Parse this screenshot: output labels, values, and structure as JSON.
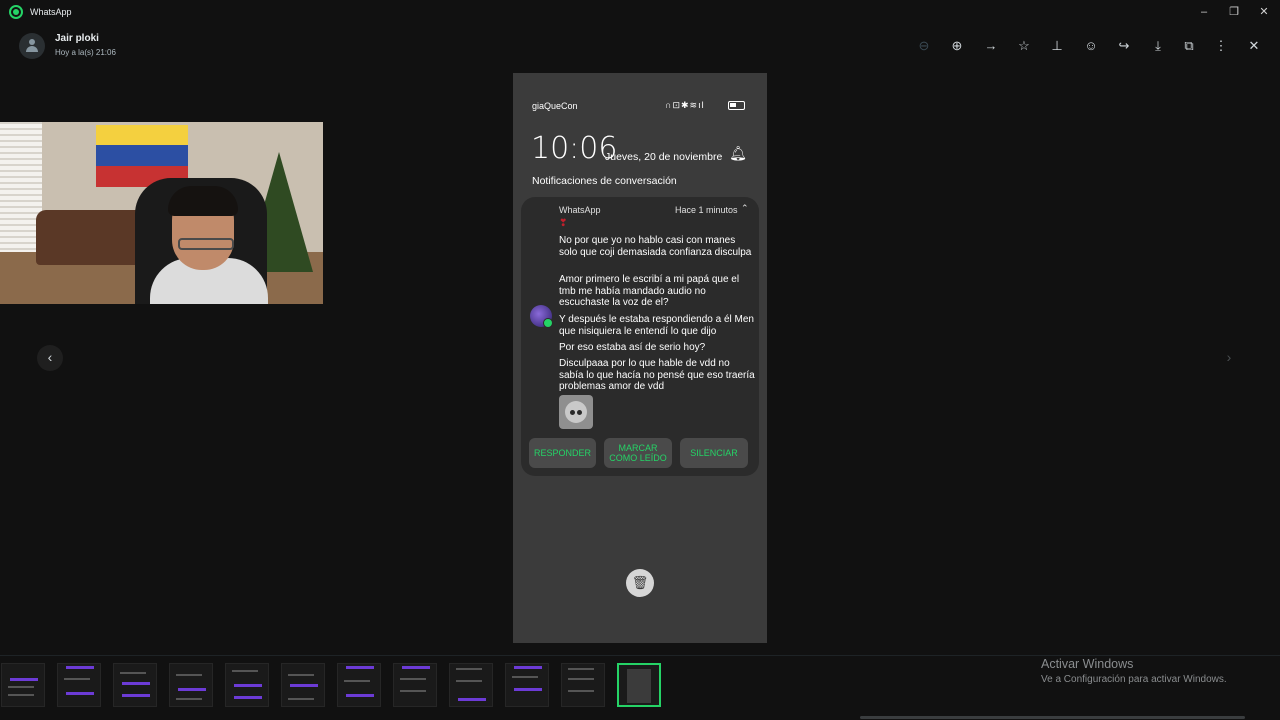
{
  "titlebar": {
    "app_title": "WhatsApp",
    "minimize_icon": "minimize-icon",
    "maximize_icon": "restore-icon",
    "close_icon": "close-icon"
  },
  "header": {
    "contact_name": "Jair ploki",
    "timestamp": "Hoy a la(s) 21:06",
    "toolbar_icons": [
      "zoom-out-icon",
      "zoom-in-icon",
      "arrow-right-icon",
      "star-icon",
      "pin-icon",
      "emoji-icon",
      "forward-icon",
      "download-icon",
      "open-external-icon",
      "more-vertical-icon",
      "close-icon"
    ]
  },
  "phone": {
    "carrier": "giaQueCon",
    "clock": "10:06",
    "date": "Jueves, 20 de noviembre",
    "section_title": "Notificaciones de conversación",
    "notification": {
      "app_name": "WhatsApp",
      "time": "Hace 1 minutos",
      "heart": "❣",
      "messages": [
        "No por que yo no hablo casi con manes solo que coji demasiada confianza disculpa",
        "Amor primero le escribí a mi papá que el tmb me había mandado audio no escuchaste la voz de el?",
        "Y después le estaba respondiendo a él Men que nisiquiera le entendí lo que dijo",
        "Por eso estaba así de serio hoy?",
        "Disculpaaa por lo que hable de vdd no sabía lo que hacía no pensé que eso traería problemas amor de vdd"
      ],
      "actions": {
        "reply": "RESPONDER",
        "mark_read": "MARCAR COMO LEÍDO",
        "mute": "SILENCIAR"
      }
    }
  },
  "watermark": {
    "title": "Activar Windows",
    "subtitle": "Ve a Configuración para activar Windows."
  },
  "colors": {
    "accent": "#25d366",
    "background": "#111111",
    "phone_bg": "#3b3b3b",
    "card_bg": "#2b2b2b"
  }
}
